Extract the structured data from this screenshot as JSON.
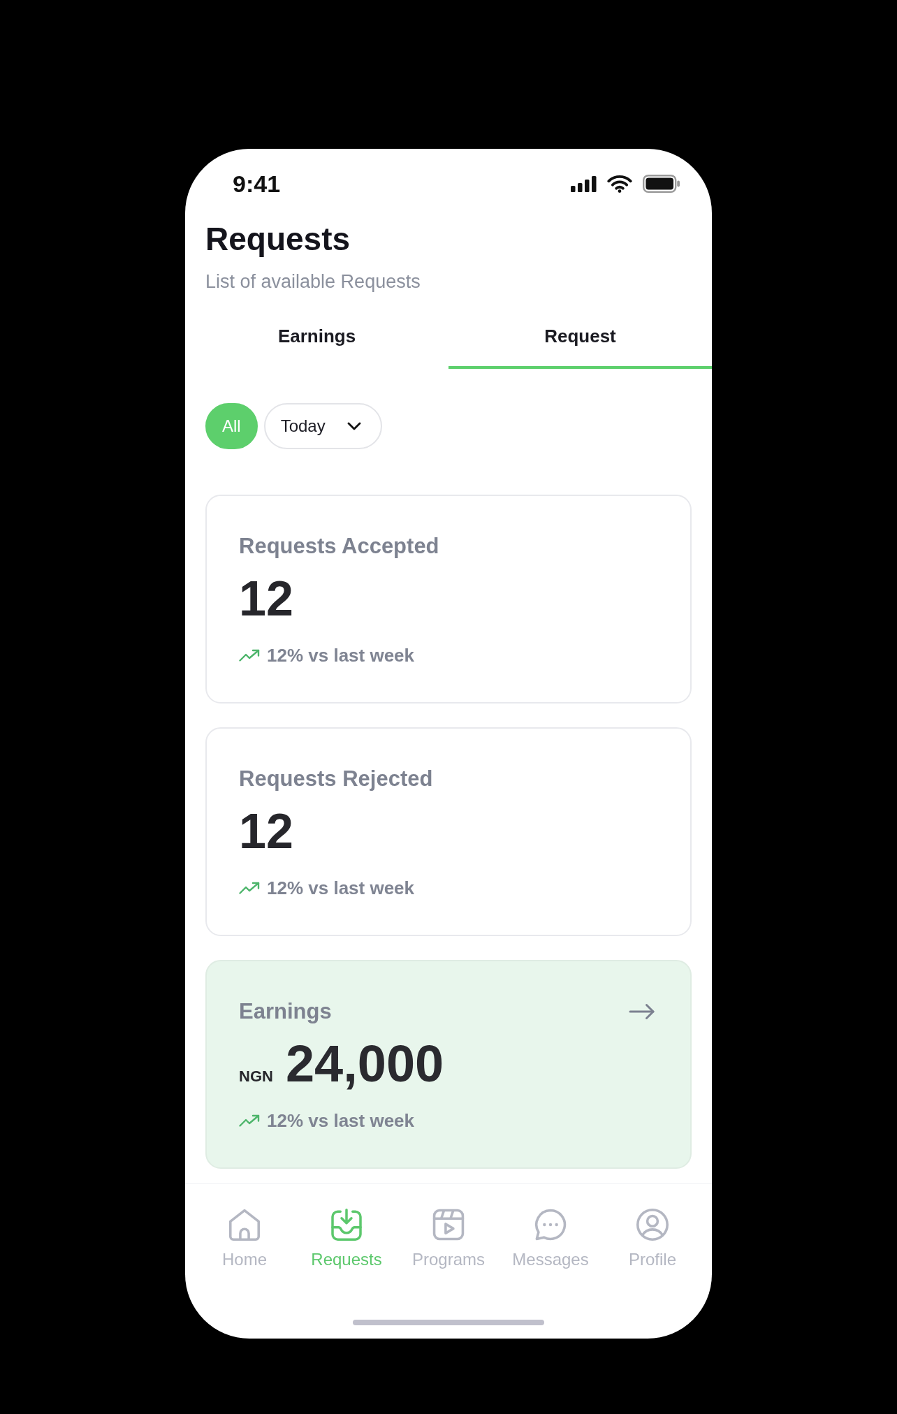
{
  "status_bar": {
    "time": "9:41"
  },
  "header": {
    "title": "Requests",
    "subtitle": "List of available Requests"
  },
  "tabs": [
    {
      "label": "Earnings",
      "selected": false
    },
    {
      "label": "Request",
      "selected": true
    }
  ],
  "filters": [
    {
      "kind": "chip",
      "label": "All",
      "selected": true
    },
    {
      "kind": "dropdown",
      "label": "Today",
      "selected": false
    }
  ],
  "stats": [
    {
      "kind": "count",
      "title": "Requests Accepted",
      "value": "12",
      "trend": "12% vs last week",
      "highlighted": false
    },
    {
      "kind": "count",
      "title": "Requests Rejected",
      "value": "12",
      "trend": "12% vs last week",
      "highlighted": false
    },
    {
      "kind": "money",
      "title": "Earnings",
      "currency": "NGN",
      "value": "24,000",
      "trend": "12% vs last week",
      "highlighted": true
    }
  ],
  "bottom_nav": [
    {
      "label": "Home",
      "selected": false
    },
    {
      "label": "Requests",
      "selected": true
    },
    {
      "label": "Programs",
      "selected": false
    },
    {
      "label": "Messages",
      "selected": false
    },
    {
      "label": "Profile",
      "selected": false
    }
  ]
}
